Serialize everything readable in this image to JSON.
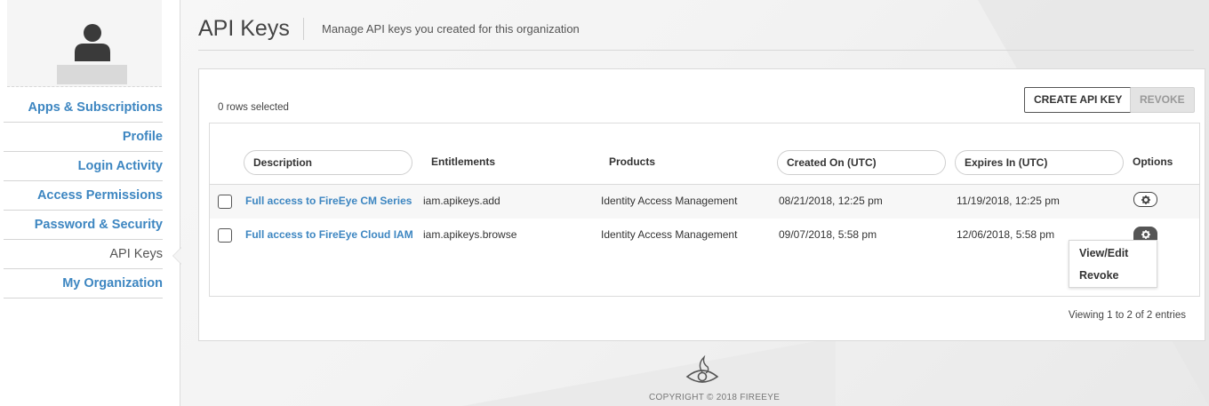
{
  "sidebar": {
    "items": [
      {
        "label": "Apps & Subscriptions"
      },
      {
        "label": "Profile"
      },
      {
        "label": "Login Activity"
      },
      {
        "label": "Access Permissions"
      },
      {
        "label": "Password & Security"
      },
      {
        "label": "API Keys",
        "active": true
      },
      {
        "label": "My Organization"
      }
    ]
  },
  "header": {
    "title": "API Keys",
    "subtitle": "Manage API keys you created for this organization"
  },
  "toolbar": {
    "rows_selected": "0 rows selected",
    "create_label": "CREATE API KEY",
    "revoke_label": "REVOKE"
  },
  "table": {
    "columns": [
      "Description",
      "Entitlements",
      "Products",
      "Created On (UTC)",
      "Expires In (UTC)",
      "Options"
    ],
    "rows": [
      {
        "description": "Full access to FireEye CM Series",
        "entitlements": "iam.apikeys.add",
        "products": "Identity Access Management",
        "created": "08/21/2018, 12:25 pm",
        "expires": "11/19/2018, 12:25 pm"
      },
      {
        "description": "Full access to FireEye Cloud IAM",
        "entitlements": "iam.apikeys.browse",
        "products": "Identity Access Management",
        "created": "09/07/2018, 5:58 pm",
        "expires": "12/06/2018, 5:58 pm"
      }
    ],
    "options_menu": [
      "View/Edit",
      "Revoke"
    ],
    "viewing": "Viewing 1 to 2 of 2 entries"
  },
  "footer": {
    "copyright": "COPYRIGHT © 2018 FIREEYE"
  },
  "colors": {
    "link": "#3d86c1",
    "background": "#f0f0f0"
  },
  "icons": [
    "user-avatar-icon",
    "gear-icon",
    "fireeye-logo-icon"
  ]
}
